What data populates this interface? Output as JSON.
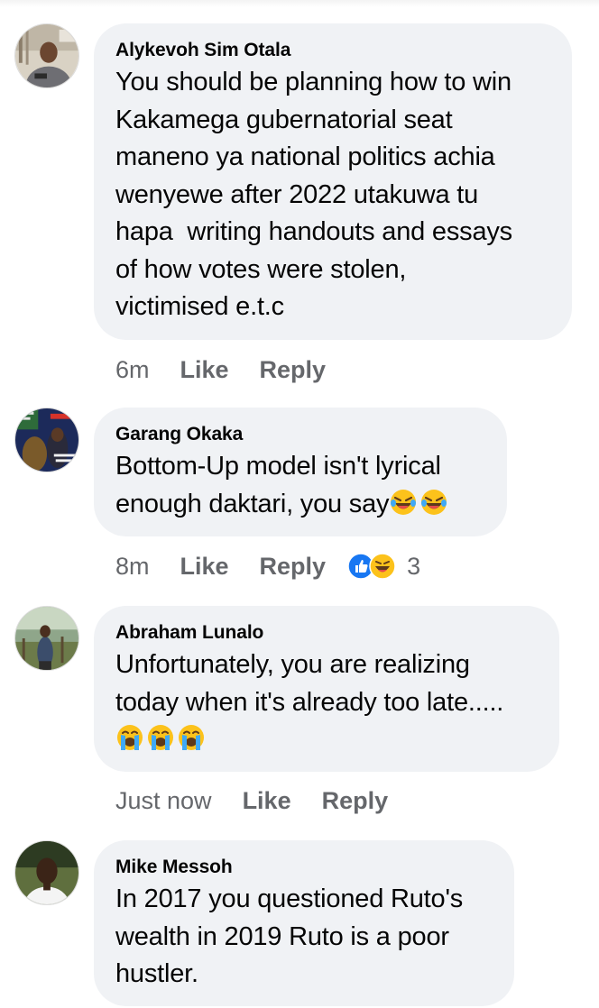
{
  "comments": [
    {
      "author": "Alykevoh Sim Otala",
      "lines": [
        "You should be planning how to win",
        "Kakamega gubernatorial seat",
        "maneno ya national politics achia",
        "wenyewe after 2022 utakuwa tu",
        "hapa  writing handouts and essays",
        "of how votes were stolen,",
        "victimised e.t.c"
      ],
      "time": "6m",
      "like_label": "Like",
      "reply_label": "Reply"
    },
    {
      "author": "Garang Okaka",
      "lines": [
        "Bottom-Up model isn't lyrical",
        "enough daktari, you say"
      ],
      "emoji": [
        "laughing-face",
        "laughing-face"
      ],
      "time": "8m",
      "like_label": "Like",
      "reply_label": "Reply",
      "reactions": [
        "like",
        "haha"
      ],
      "reaction_count": "3"
    },
    {
      "author": "Abraham Lunalo",
      "lines": [
        "Unfortunately, you are realizing",
        "today when it's already too late....."
      ],
      "emoji": [
        "loudly-crying-face",
        "loudly-crying-face",
        "loudly-crying-face"
      ],
      "time": "Just now",
      "like_label": "Like",
      "reply_label": "Reply"
    },
    {
      "author": "Mike Messoh",
      "lines": [
        "In 2017 you questioned Ruto's",
        "wealth in 2019 Ruto is a poor",
        "hustler."
      ]
    }
  ],
  "colors": {
    "bubble": "#f0f2f5",
    "meta_text": "#65676b",
    "like_blue": "#1877f2",
    "emoji_yellow": "#fcc21b"
  }
}
